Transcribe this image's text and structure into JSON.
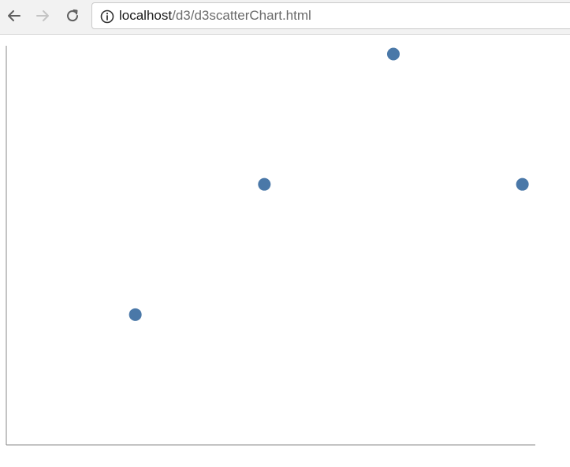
{
  "browser": {
    "url_host": "localhost",
    "url_path": "/d3/d3scatterChart.html",
    "icons": {
      "back": "arrow-left-icon",
      "forward": "arrow-right-icon",
      "reload": "reload-icon",
      "info": "info-icon"
    }
  },
  "chart_data": {
    "type": "scatter",
    "title": "",
    "xlabel": "",
    "ylabel": "",
    "x": [
      1,
      2,
      3,
      4
    ],
    "y": [
      1,
      2,
      3,
      2
    ],
    "xlim": [
      0,
      4.1
    ],
    "ylim": [
      0,
      3.1
    ],
    "grid": false,
    "axes_visible": {
      "x_axis_line": true,
      "y_axis_line": true,
      "tick_labels": false
    },
    "point_color": "#4a78a8",
    "axis_color": "#8a8a8a"
  }
}
